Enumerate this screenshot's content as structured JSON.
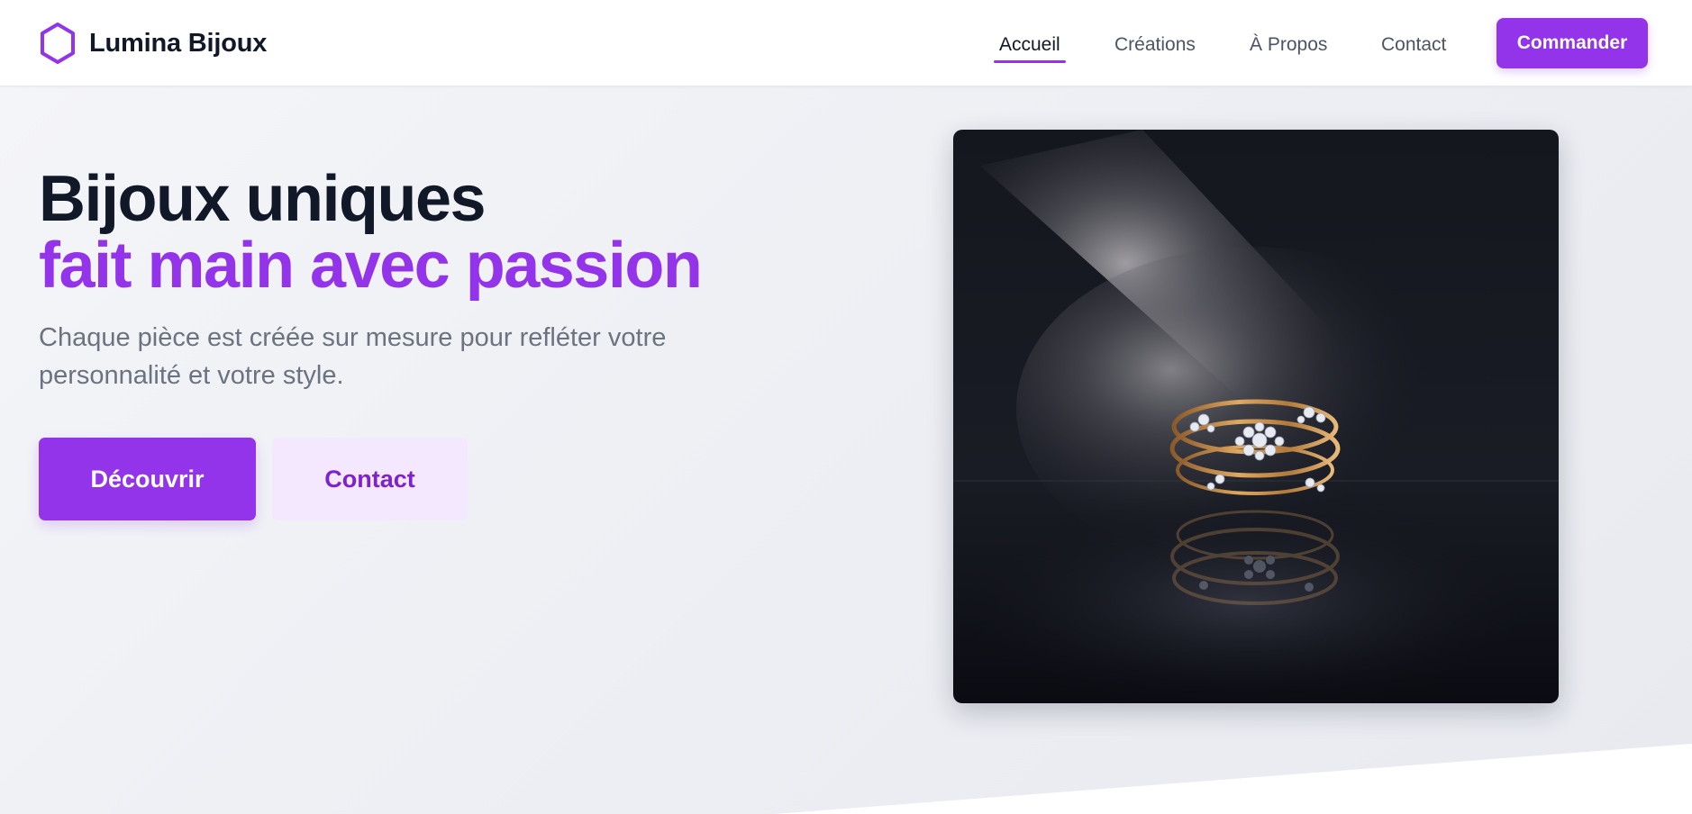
{
  "brand": {
    "name": "Lumina Bijoux",
    "logo_icon": "hexagon-outline-icon",
    "accent_color": "#9333ea"
  },
  "nav": {
    "links": [
      {
        "label": "Accueil",
        "active": true
      },
      {
        "label": "Créations",
        "active": false
      },
      {
        "label": "À Propos",
        "active": false
      },
      {
        "label": "Contact",
        "active": false
      }
    ],
    "cta_label": "Commander"
  },
  "hero": {
    "title_line1": "Bijoux uniques",
    "title_line2": "fait main avec passion",
    "description": "Chaque pièce est créée sur mesure pour refléter votre personnalité et votre style.",
    "primary_button": "Découvrir",
    "secondary_button": "Contact",
    "image_subject": "gold ring with diamond flower clusters under spotlight, reflected on dark surface"
  }
}
